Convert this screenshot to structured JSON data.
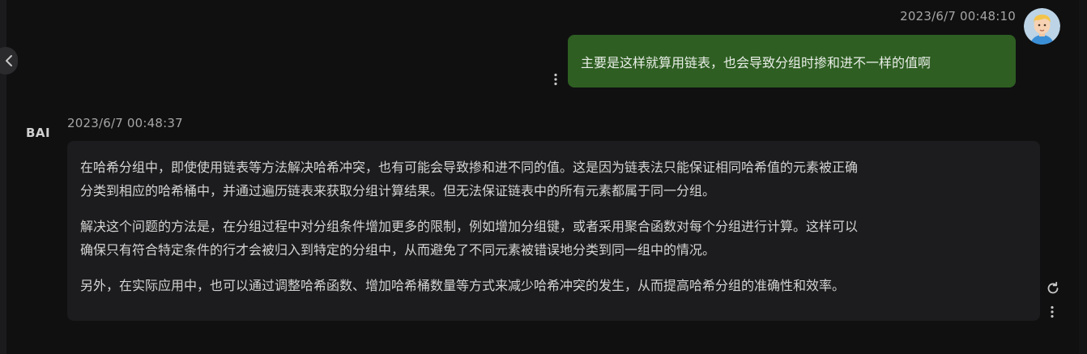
{
  "user_message": {
    "timestamp": "2023/6/7 00:48:10",
    "text": "主要是这样就算用链表，也会导致分组时掺和进不一样的值啊",
    "bubble_color": "#2e5e22"
  },
  "bot_message": {
    "avatar_label": "BAI",
    "timestamp": "2023/6/7 00:48:37",
    "paragraphs": [
      {
        "line1": "在哈希分组中，即使使用链表等方法解决哈希冲突，也有可能会导致掺和进不同的值。这是因为链表法只能保证相同哈希值的元素被正确",
        "line2": "分类到相应的哈希桶中，并通过遍历链表来获取分组计算结果。但无法保证链表中的所有元素都属于同一分组。"
      },
      {
        "line1": "解决这个问题的方法是，在分组过程中对分组条件增加更多的限制，例如增加分组键，或者采用聚合函数对每个分组进行计算。这样可以",
        "line2": "确保只有符合特定条件的行才会被归入到特定的分组中，从而避免了不同元素被错误地分类到同一组中的情况。"
      },
      {
        "line1": "另外，在实际应用中，也可以通过调整哈希函数、增加哈希桶数量等方式来减少哈希冲突的发生，从而提高哈希分组的准确性和效率。"
      }
    ],
    "bubble_color": "#1c1c1e"
  },
  "icons": {
    "collapse": "chevron-left-icon",
    "user_more": "more-vertical-icon",
    "bot_refresh": "refresh-icon",
    "bot_more": "more-vertical-icon"
  }
}
